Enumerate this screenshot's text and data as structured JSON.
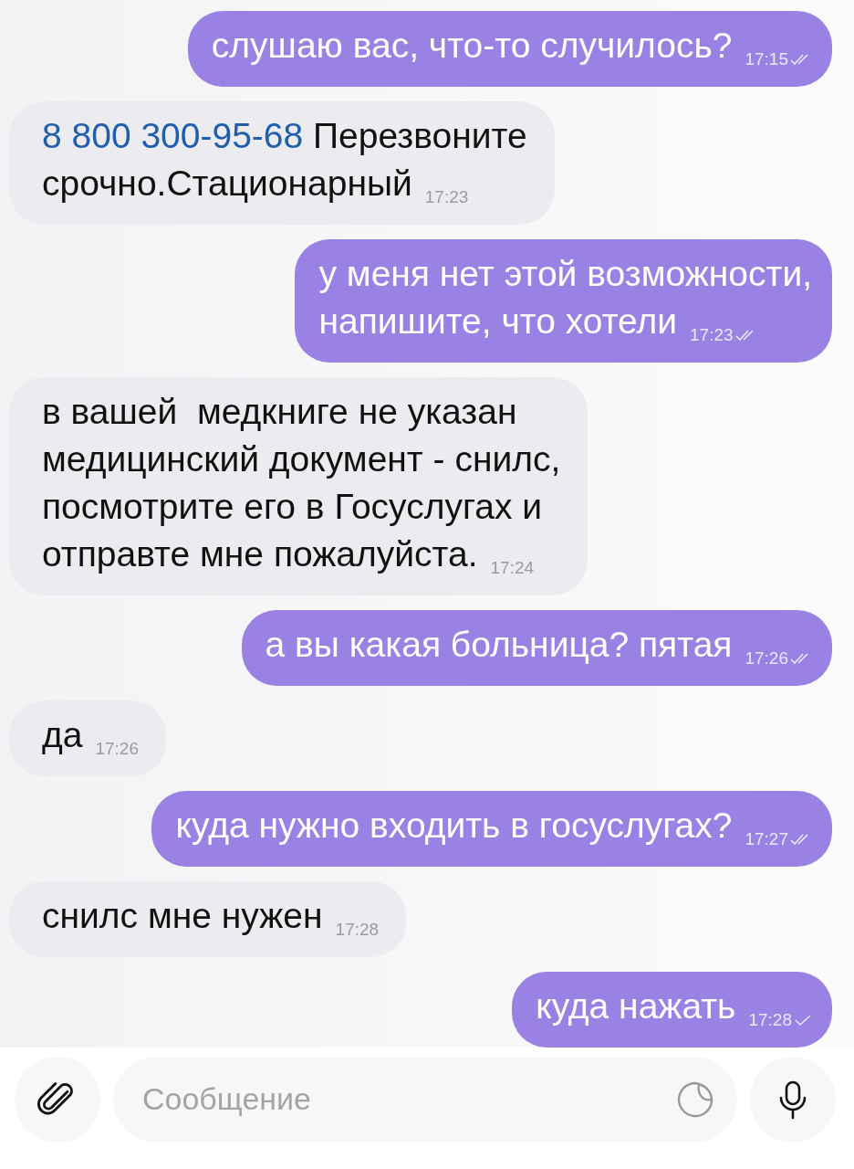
{
  "messages": [
    {
      "kind": "outgoing",
      "lines": [
        "слушаю вас, что-то случилось?"
      ],
      "time": "17:15",
      "read": true
    },
    {
      "kind": "incoming",
      "link": "8 800 300-95-68",
      "lines": [
        " Перезвоните",
        "срочно.Стационарный"
      ],
      "time": "17:23"
    },
    {
      "kind": "outgoing",
      "lines": [
        "у меня нет этой возможности,",
        "напишите, что хотели"
      ],
      "time": "17:23",
      "read": true
    },
    {
      "kind": "incoming",
      "lines": [
        "в вашей  медкниге не указан",
        "медицинский документ - снилс,",
        "посмотрите его в Госуслугах и",
        "отправте мне пожалуйста."
      ],
      "time": "17:24"
    },
    {
      "kind": "outgoing",
      "lines": [
        "а вы какая больница? пятая"
      ],
      "time": "17:26",
      "read": true
    },
    {
      "kind": "incoming",
      "lines": [
        "да"
      ],
      "time": "17:26"
    },
    {
      "kind": "outgoing",
      "lines": [
        "куда нужно входить в госуслугах?"
      ],
      "time": "17:27",
      "read": true
    },
    {
      "kind": "incoming",
      "lines": [
        "снилс мне нужен"
      ],
      "time": "17:28"
    },
    {
      "kind": "outgoing",
      "lines": [
        "куда нажать"
      ],
      "time": "17:28",
      "read": false
    }
  ],
  "composer": {
    "placeholder": "Сообщение"
  }
}
